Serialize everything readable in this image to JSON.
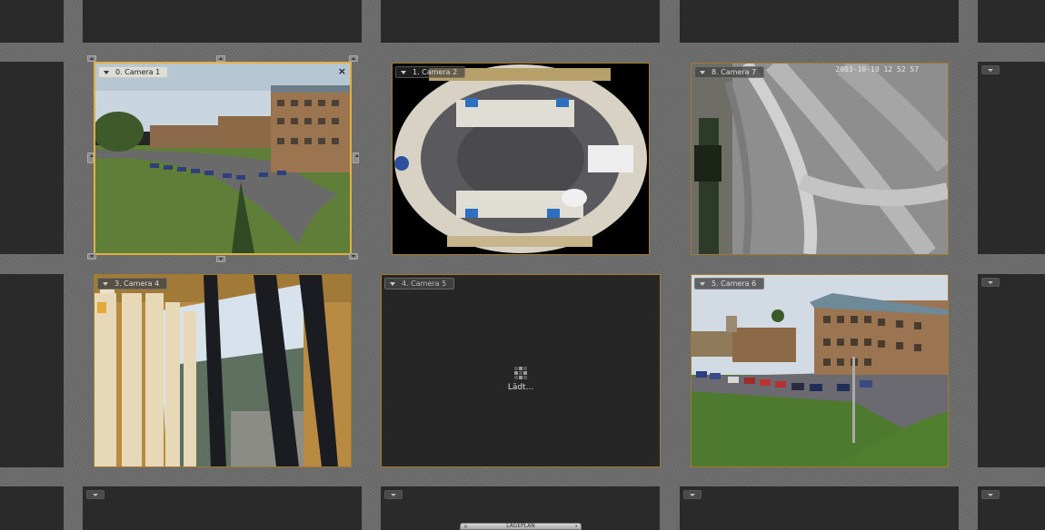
{
  "cameras": [
    {
      "label": "0. Camera 1"
    },
    {
      "label": "1. Camera 2"
    },
    {
      "label": "8. Camera 7"
    },
    {
      "label": "3. Camera 4"
    },
    {
      "label": "4. Camera 5"
    },
    {
      "label": "5. Camera 6"
    }
  ],
  "active_close": "×",
  "camera7_timestamp": "2003-10-10  12 52 57",
  "loading_text": "Lädt...",
  "bottom_tab": {
    "label": "LAGEPLAN",
    "left_mark": "×",
    "right_mark": "•"
  },
  "colors": {
    "active_border": "#e2b03c",
    "inactive_border": "#a27a2c",
    "tile_bg": "#262626"
  }
}
